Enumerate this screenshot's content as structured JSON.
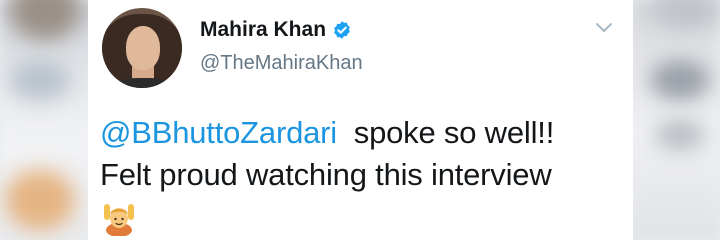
{
  "tweet": {
    "display_name": "Mahira Khan",
    "handle": "@TheMahiraKhan",
    "mention": "@BBhuttoZardari",
    "text_after_mention": "  spoke so well!!",
    "line2": "Felt proud watching this interview",
    "emoji": "person-raising-both-hands-icon"
  },
  "colors": {
    "link_blue": "#1b95e0",
    "verified_blue": "#1da1f2",
    "handle_gray": "#657786",
    "text_dark": "#14171a"
  }
}
